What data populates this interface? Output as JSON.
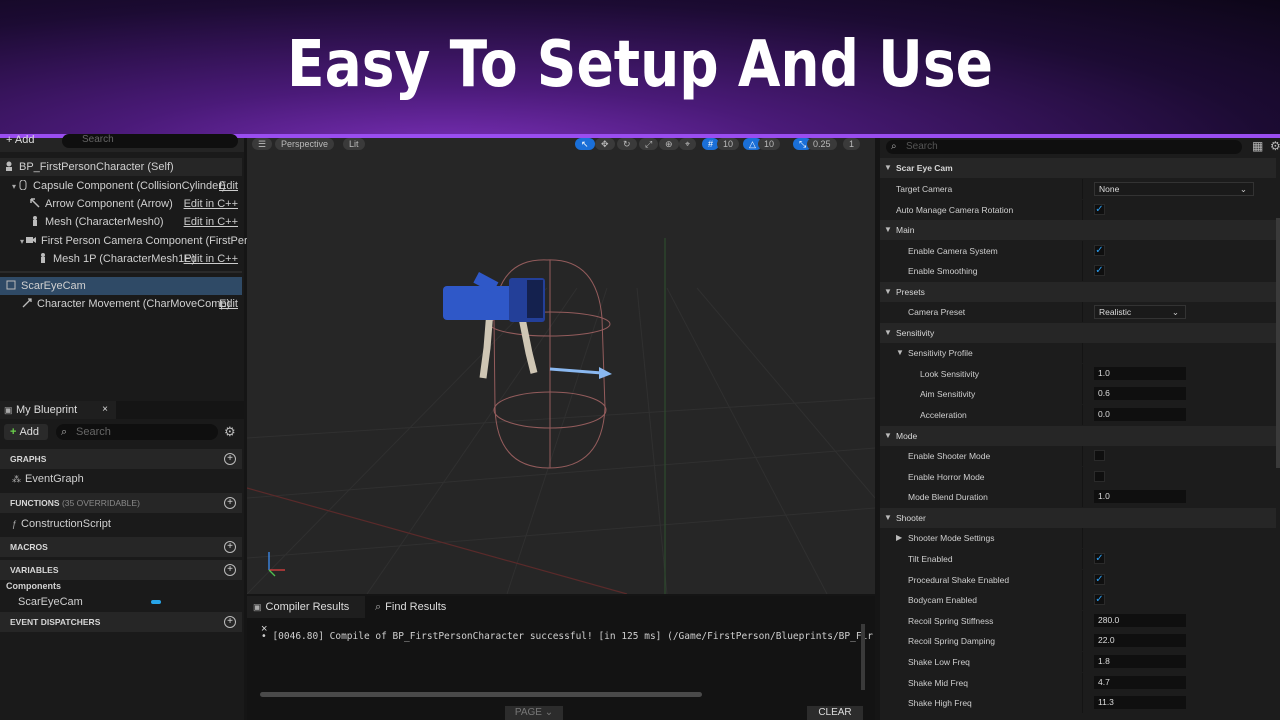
{
  "banner": {
    "title": "Easy To Setup And Use"
  },
  "components": {
    "add_label": "+ Add",
    "search_placeholder": "Search",
    "items": [
      {
        "label": "BP_FirstPersonCharacter (Self)",
        "edit": ""
      },
      {
        "label": "Capsule Component (CollisionCylinder)",
        "edit": "Edit"
      },
      {
        "label": "Arrow Component (Arrow)",
        "edit": "Edit in C++"
      },
      {
        "label": "Mesh (CharacterMesh0)",
        "edit": "Edit in C++"
      },
      {
        "label": "First Person Camera Component (FirstPers",
        "edit": ""
      },
      {
        "label": "Mesh 1P (CharacterMesh1P)",
        "edit": "Edit in C++"
      },
      {
        "label": "ScarEyeCam",
        "edit": ""
      },
      {
        "label": "Character Movement (CharMoveComp)",
        "edit": "Edit"
      }
    ]
  },
  "my_blueprint": {
    "tab_label": "My Blueprint",
    "close": "×",
    "add_label": "Add",
    "search_placeholder": "Search",
    "sections": {
      "graphs": "GRAPHS",
      "graph_item": "EventGraph",
      "functions": "FUNCTIONS",
      "functions_sub": "(35 OVERRIDABLE)",
      "function_item": "ConstructionScript",
      "macros": "MACROS",
      "variables": "VARIABLES",
      "components_group": "Components",
      "var_item": "ScarEyeCam",
      "dispatchers": "EVENT DISPATCHERS"
    }
  },
  "viewport": {
    "perspective": "Perspective",
    "lit": "Lit",
    "grid_snap": "10",
    "rot_snap": "10",
    "scale_snap": "0.25",
    "cam_speed": "1"
  },
  "console": {
    "tab1": "Compiler Results",
    "tab2": "Find Results",
    "message": "[0046.80] Compile of BP_FirstPersonCharacter successful! [in 125 ms] (/Game/FirstPerson/Blueprints/BP_Fir",
    "page": "PAGE",
    "clear": "CLEAR"
  },
  "details": {
    "search_placeholder": "Search",
    "rows": {
      "scar_eye_cam": "Scar Eye Cam",
      "target_camera": "Target Camera",
      "target_camera_val": "None",
      "auto_manage": "Auto Manage Camera Rotation",
      "main": "Main",
      "enable_camera": "Enable Camera System",
      "enable_smoothing": "Enable Smoothing",
      "presets": "Presets",
      "camera_preset": "Camera Preset",
      "camera_preset_val": "Realistic",
      "sensitivity": "Sensitivity",
      "sensitivity_profile": "Sensitivity Profile",
      "look_sens": "Look Sensitivity",
      "look_sens_val": "1.0",
      "aim_sens": "Aim Sensitivity",
      "aim_sens_val": "0.6",
      "accel": "Acceleration",
      "accel_val": "0.0",
      "mode": "Mode",
      "shooter_mode": "Enable Shooter Mode",
      "horror_mode": "Enable Horror Mode",
      "blend_dur": "Mode Blend Duration",
      "blend_dur_val": "1.0",
      "shooter": "Shooter",
      "shooter_settings": "Shooter Mode Settings",
      "tilt": "Tilt Enabled",
      "proc_shake": "Procedural Shake Enabled",
      "bodycam": "Bodycam Enabled",
      "recoil_stiff": "Recoil Spring Stiffness",
      "recoil_stiff_val": "280.0",
      "recoil_damp": "Recoil Spring Damping",
      "recoil_damp_val": "22.0",
      "shake_low": "Shake Low Freq",
      "shake_low_val": "1.8",
      "shake_mid": "Shake Mid Freq",
      "shake_mid_val": "4.7",
      "shake_high": "Shake High Freq",
      "shake_high_val": "11.3"
    }
  },
  "colors": {
    "accent": "#9a4df0",
    "select": "#2f4a66",
    "check": "#2a9df0"
  }
}
